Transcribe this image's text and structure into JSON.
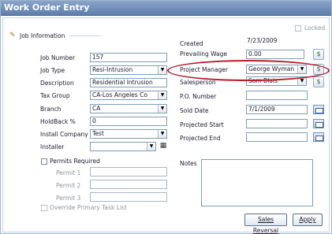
{
  "window": {
    "title": "Work Order Entry"
  },
  "locked": {
    "label": "Locked",
    "checked": false
  },
  "section": {
    "label": "Job Information"
  },
  "left": {
    "job_number": {
      "label": "Job Number",
      "value": "157"
    },
    "job_type": {
      "label": "Job Type",
      "value": "Resi-Intrusion"
    },
    "description": {
      "label": "Description",
      "value": "Residential Intrusion"
    },
    "tax_group": {
      "label": "Tax Group",
      "value": "CA-Los Angeles Co"
    },
    "branch": {
      "label": "Branch",
      "value": "CA"
    },
    "holdback": {
      "label": "HoldBack %",
      "value": "0"
    },
    "install_company": {
      "label": "Install Company",
      "value": "Test"
    },
    "installer": {
      "label": "Installer",
      "value": ""
    },
    "permits_required": {
      "label": "Permits Required",
      "checked": false
    },
    "permit1": {
      "label": "Permit 1",
      "value": ""
    },
    "permit2": {
      "label": "Permit 2",
      "value": ""
    },
    "permit3": {
      "label": "Permit 3",
      "value": ""
    },
    "override": {
      "label": "Override Primary Task List",
      "checked": false
    }
  },
  "right": {
    "created": {
      "label": "Created",
      "value": "7/23/2009"
    },
    "prevailing_wage": {
      "label": "Prevailing Wage",
      "value": "0.00"
    },
    "project_manager": {
      "label": "Project Manager",
      "value": "George Wyman"
    },
    "salesperson": {
      "label": "Salesperson",
      "value": "Sam Blais"
    },
    "po_number": {
      "label": "P.O. Number",
      "value": ""
    },
    "sold_date": {
      "label": "Sold Date",
      "value": "7/1/2009"
    },
    "projected_start": {
      "label": "Projected Start",
      "value": ""
    },
    "projected_end": {
      "label": "Projected End",
      "value": ""
    },
    "notes": {
      "label": "Notes",
      "value": ""
    }
  },
  "buttons": {
    "sales_reversal": "Sales Reversal",
    "apply": "Apply"
  },
  "icons": {
    "section": "wrench-icon",
    "dollar": "dollar-icon",
    "calendar": "calendar-icon",
    "installer": "installer-lookup-icon"
  },
  "colors": {
    "titlebar": "#6f8cb6",
    "highlight_oval": "#b61e2a"
  }
}
